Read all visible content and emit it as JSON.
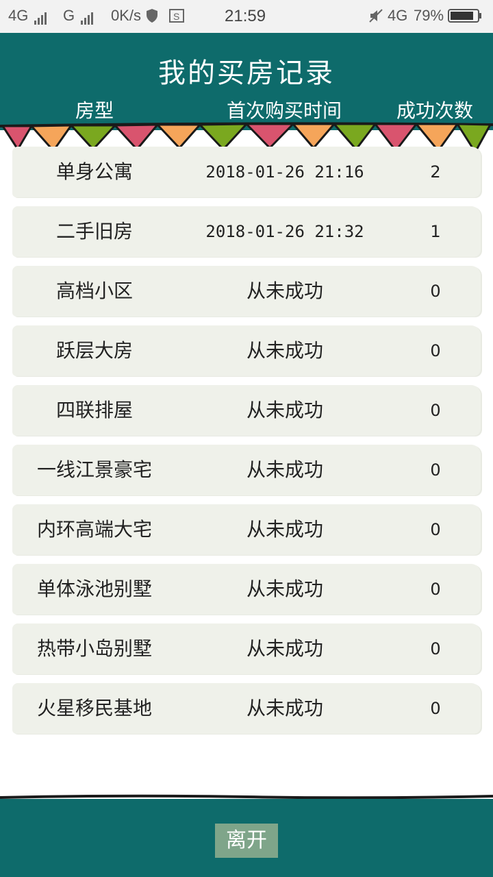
{
  "status_bar": {
    "network1": "4G",
    "network2": "G",
    "speed": "0K/s",
    "time": "21:59",
    "network3": "4G",
    "battery": "79%"
  },
  "header": {
    "title": "我的买房记录",
    "columns": [
      "房型",
      "首次购买时间",
      "成功次数"
    ]
  },
  "rows": [
    {
      "type": "单身公寓",
      "time": "2018-01-26  21:16",
      "count": "2"
    },
    {
      "type": "二手旧房",
      "time": "2018-01-26  21:32",
      "count": "1"
    },
    {
      "type": "高档小区",
      "time": "从未成功",
      "count": "0"
    },
    {
      "type": "跃层大房",
      "time": "从未成功",
      "count": "0"
    },
    {
      "type": "四联排屋",
      "time": "从未成功",
      "count": "0"
    },
    {
      "type": "一线江景豪宅",
      "time": "从未成功",
      "count": "0"
    },
    {
      "type": "内环高端大宅",
      "time": "从未成功",
      "count": "0"
    },
    {
      "type": "单体泳池别墅",
      "time": "从未成功",
      "count": "0"
    },
    {
      "type": "热带小岛别墅",
      "time": "从未成功",
      "count": "0"
    },
    {
      "type": "火星移民基地",
      "time": "从未成功",
      "count": "0"
    }
  ],
  "footer": {
    "leave_label": "离开"
  },
  "colors": {
    "header_bg": "#0e6b6b",
    "row_bg": "#eff1ea",
    "flag_pink": "#d9546e",
    "flag_orange": "#f5a55a",
    "flag_green": "#7aa81f",
    "button_bg": "#7fa58a"
  }
}
